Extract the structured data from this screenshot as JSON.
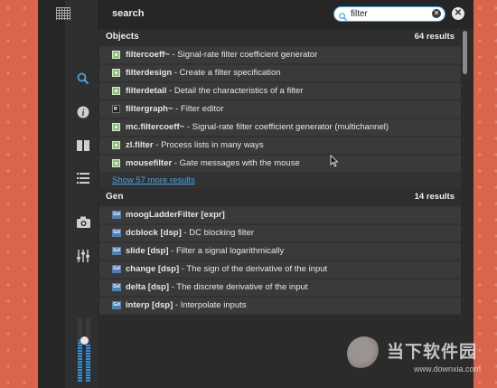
{
  "search": {
    "title": "search",
    "query": "filter",
    "placeholder": "",
    "clear_glyph": "✕",
    "close_glyph": "✕"
  },
  "sidebar": {
    "icons": [
      "grid-icon",
      "search-icon",
      "info-icon",
      "book-icon",
      "list-icon",
      "camera-icon",
      "sliders-icon"
    ],
    "active": "search-icon",
    "level_meter": 0.65
  },
  "sections": [
    {
      "title": "Objects",
      "count": "64 results",
      "items": [
        {
          "icon": "msp",
          "name": "filtercoeff~",
          "desc": " - Signal-rate filter coefficient generator"
        },
        {
          "icon": "msp",
          "name": "filterdesign",
          "desc": " - Create a filter specification"
        },
        {
          "icon": "msp",
          "name": "filterdetail",
          "desc": " - Detail the characteristics of a filter"
        },
        {
          "icon": "jit",
          "name": "filtergraph~",
          "desc": " - Filter editor"
        },
        {
          "icon": "msp",
          "name": "mc.filtercoeff~",
          "desc": " - Signal-rate filter coefficient generator (multichannel)"
        },
        {
          "icon": "msp",
          "name": "zl.filter",
          "desc": " - Process lists in many ways"
        },
        {
          "icon": "msp",
          "name": "mousefilter",
          "desc": " - Gate messages with the mouse"
        }
      ],
      "more": "Show 57 more results"
    },
    {
      "title": "Gen",
      "count": "14 results",
      "items": [
        {
          "icon": "gen",
          "name": "moogLadderFilter [expr]",
          "desc": ""
        },
        {
          "icon": "gen",
          "name": "dcblock [dsp]",
          "desc": " - DC blocking filter"
        },
        {
          "icon": "gen",
          "name": "slide [dsp]",
          "desc": " - Filter a signal logarithmically"
        },
        {
          "icon": "gen",
          "name": "change [dsp]",
          "desc": " - The sign of the derivative of the input"
        },
        {
          "icon": "gen",
          "name": "delta [dsp]",
          "desc": " - The discrete derivative of the input"
        },
        {
          "icon": "gen",
          "name": "interp [dsp]",
          "desc": " - Interpolate inputs"
        }
      ]
    }
  ],
  "gen_icon_text": "Gd",
  "watermark": {
    "title": "当下软件园",
    "url": "www.downxia.com"
  },
  "colors": {
    "accent": "#4aa3df",
    "background": "#d9654c",
    "panel": "#2b2b2b"
  }
}
